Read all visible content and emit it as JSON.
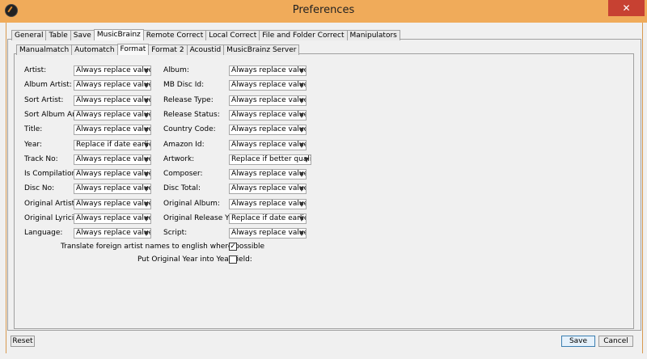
{
  "window": {
    "title": "Preferences",
    "close_glyph": "✕"
  },
  "main_tabs": [
    "General",
    "Table",
    "Save",
    "MusicBrainz",
    "Remote Correct",
    "Local Correct",
    "File and Folder Correct",
    "Manipulators"
  ],
  "main_active": "MusicBrainz",
  "sub_tabs": [
    "Manualmatch",
    "Automatch",
    "Format",
    "Format 2",
    "Acoustid",
    "MusicBrainz Server"
  ],
  "sub_active": "Format",
  "left_fields": [
    {
      "label": "Artist:",
      "value": "Always replace values"
    },
    {
      "label": "Album Artist:",
      "value": "Always replace values"
    },
    {
      "label": "Sort Artist:",
      "value": "Always replace values"
    },
    {
      "label": "Sort Album Artist:",
      "value": "Always replace values"
    },
    {
      "label": "Title:",
      "value": "Always replace values"
    },
    {
      "label": "Year:",
      "value": "Replace if date earlier"
    },
    {
      "label": "Track No:",
      "value": "Always replace values"
    },
    {
      "label": "Is Compilation:",
      "value": "Always replace values"
    },
    {
      "label": "Disc No:",
      "value": "Always replace values"
    },
    {
      "label": "Original Artist:",
      "value": "Always replace values"
    },
    {
      "label": "Original Lyricist:",
      "value": "Always replace values"
    },
    {
      "label": "Language:",
      "value": "Always replace values"
    }
  ],
  "right_fields": [
    {
      "label": "Album:",
      "value": "Always replace values"
    },
    {
      "label": "MB Disc Id:",
      "value": "Always replace values"
    },
    {
      "label": "Release Type:",
      "value": "Always replace values"
    },
    {
      "label": "Release Status:",
      "value": "Always replace values"
    },
    {
      "label": "Country Code:",
      "value": "Always replace values"
    },
    {
      "label": "Amazon Id:",
      "value": "Always replace values"
    },
    {
      "label": "Artwork:",
      "value": "Replace if better quality"
    },
    {
      "label": "Composer:",
      "value": "Always replace values"
    },
    {
      "label": "Disc Total:",
      "value": "Always replace values"
    },
    {
      "label": "Original Album:",
      "value": "Always replace values"
    },
    {
      "label": "Original Release Year:",
      "value": "Replace if date earlier"
    },
    {
      "label": "Script:",
      "value": "Always replace values"
    }
  ],
  "checkboxes": [
    {
      "label": "Translate foreign artist names to english where possible",
      "checked": true,
      "mark": "✓"
    },
    {
      "label": "Put Original Year into Year field:",
      "checked": false,
      "mark": ""
    }
  ],
  "buttons": {
    "reset": "Reset",
    "save": "Save",
    "cancel": "Cancel"
  },
  "colors": {
    "titlebar": "#f0ab5a",
    "close": "#c74132"
  }
}
